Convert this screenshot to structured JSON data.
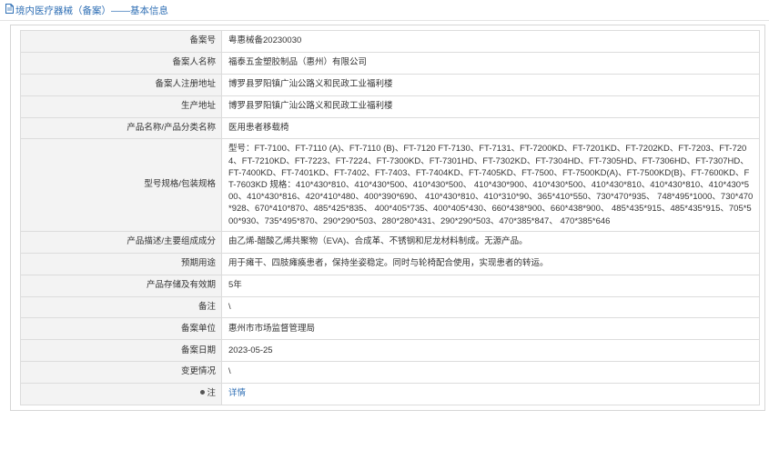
{
  "header": {
    "title": "境内医疗器械（备案）——基本信息"
  },
  "rows": [
    {
      "label": "备案号",
      "value": "粤惠械备20230030"
    },
    {
      "label": "备案人名称",
      "value": "福泰五金塑胶制品（惠州）有限公司"
    },
    {
      "label": "备案人注册地址",
      "value": "博罗县罗阳镇广汕公路义和民政工业福利楼"
    },
    {
      "label": "生产地址",
      "value": "博罗县罗阳镇广汕公路义和民政工业福利楼"
    },
    {
      "label": "产品名称/产品分类名称",
      "value": "医用患者移载椅"
    },
    {
      "label": "型号规格/包装规格",
      "value": "型号：FT-7100、FT-7110 (A)、FT-7110 (B)、FT-7120 FT-7130、FT-7131、FT-7200KD、FT-7201KD、FT-7202KD、FT-7203、FT-7204、FT-7210KD、FT-7223、FT-7224、FT-7300KD、FT-7301HD、FT-7302KD、FT-7304HD、FT-7305HD、FT-7306HD、FT-7307HD、FT-7400KD、FT-7401KD、FT-7402、FT-7403、FT-7404KD、FT-7405KD、FT-7500、FT-7500KD(A)、FT-7500KD(B)、FT-7600KD、FT-7603KD 规格：410*430*810、410*430*500、410*430*500、 410*430*900、410*430*500、410*430*810、410*430*810、410*430*500、410*430*816、420*410*480、400*390*690、 410*430*810、410*310*90、365*410*550、730*470*935、 748*495*1000、730*470*928、670*410*870、485*425*835、 400*405*735、400*405*430、660*438*900、660*438*900、 485*435*915、485*435*915、705*500*930、735*495*870、290*290*503、280*280*431、290*290*503、470*385*847、 470*385*646"
    },
    {
      "label": "产品描述/主要组成成分",
      "value": "由乙烯-醋酸乙烯共聚物（EVA)、合成革、不锈钢和尼龙材料制成。无源产品。"
    },
    {
      "label": "预期用途",
      "value": "用于瘫干、四肢瘫痪患者，保持坐姿稳定。同时与轮椅配合使用，实现患者的转运。"
    },
    {
      "label": "产品存储及有效期",
      "value": "5年"
    },
    {
      "label": "备注",
      "value": "\\"
    },
    {
      "label": "备案单位",
      "value": "惠州市市场监督管理局"
    },
    {
      "label": "备案日期",
      "value": "2023-05-25"
    },
    {
      "label": "变更情况",
      "value": "\\"
    },
    {
      "label": "注",
      "value": "详情"
    }
  ]
}
